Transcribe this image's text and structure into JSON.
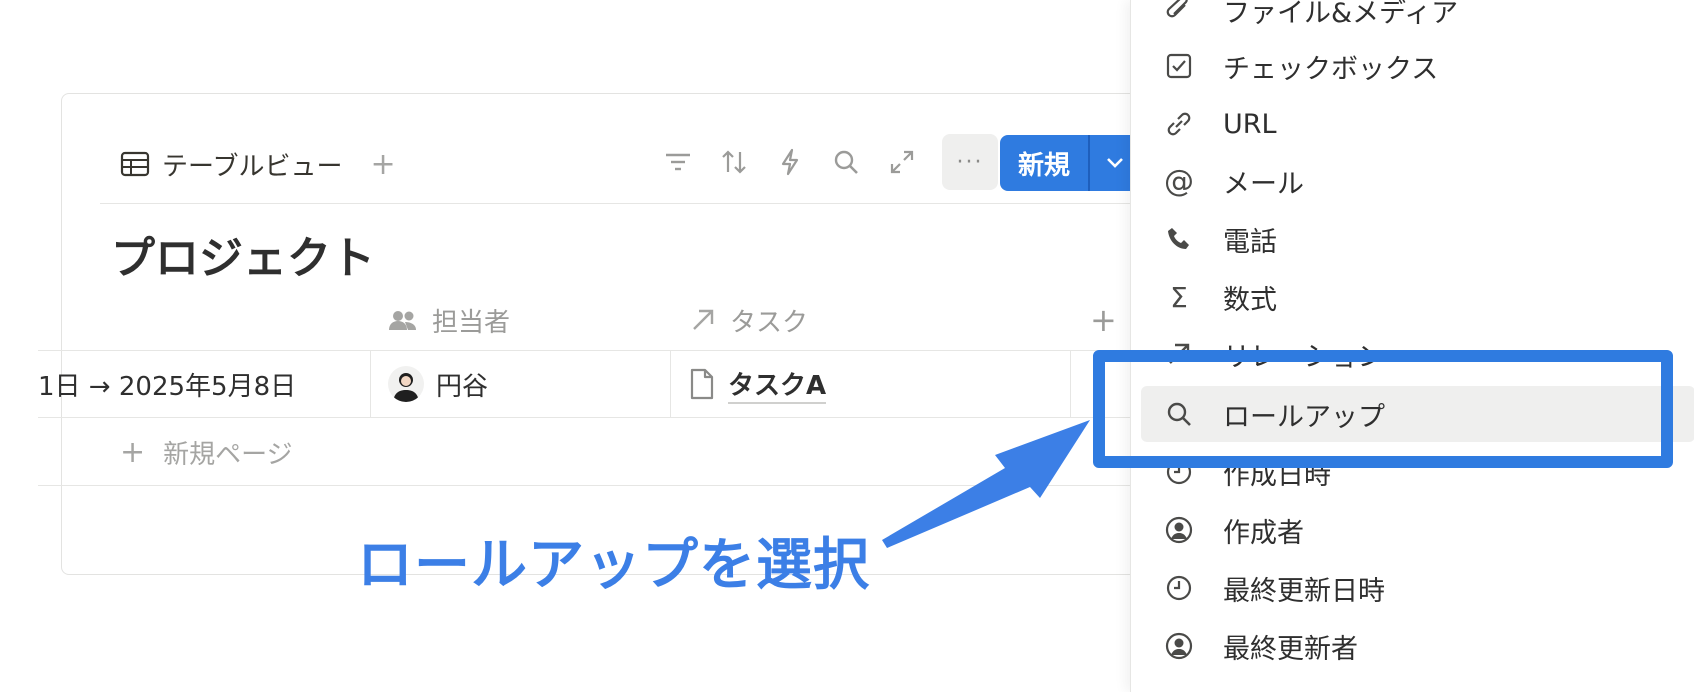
{
  "view": {
    "tab_label": "テーブルビュー",
    "add_view": "+",
    "more": "···",
    "new_label": "新規"
  },
  "page": {
    "title": "プロジェクト"
  },
  "table": {
    "columns": [
      {
        "label": "担当者",
        "icon": "people-icon"
      },
      {
        "label": "タスク",
        "icon": "relation-arrow-icon"
      }
    ],
    "add_column": "+",
    "row": {
      "date_range": "1日 → 2025年5月8日",
      "assignee": "円谷",
      "task": "タスクA"
    },
    "new_page": "新規ページ"
  },
  "annotation": "ロールアップを選択",
  "menu": {
    "items": [
      {
        "label": "ファイル&メディア",
        "icon": "paperclip-icon"
      },
      {
        "label": "チェックボックス",
        "icon": "checkbox-icon"
      },
      {
        "label": "URL",
        "icon": "link-icon"
      },
      {
        "label": "メール",
        "icon": "at-icon"
      },
      {
        "label": "電話",
        "icon": "phone-icon"
      },
      {
        "label": "数式",
        "icon": "sigma-icon"
      },
      {
        "label": "リレーション",
        "icon": "relation-arrow-icon"
      },
      {
        "label": "ロールアップ",
        "icon": "search-icon"
      },
      {
        "label": "作成日時",
        "icon": "clock-icon"
      },
      {
        "label": "作成者",
        "icon": "user-circle-icon"
      },
      {
        "label": "最終更新日時",
        "icon": "clock-icon"
      },
      {
        "label": "最終更新者",
        "icon": "user-circle-icon"
      }
    ]
  },
  "colors": {
    "accent": "#2f7be0",
    "annotation": "#3c7fe6"
  }
}
